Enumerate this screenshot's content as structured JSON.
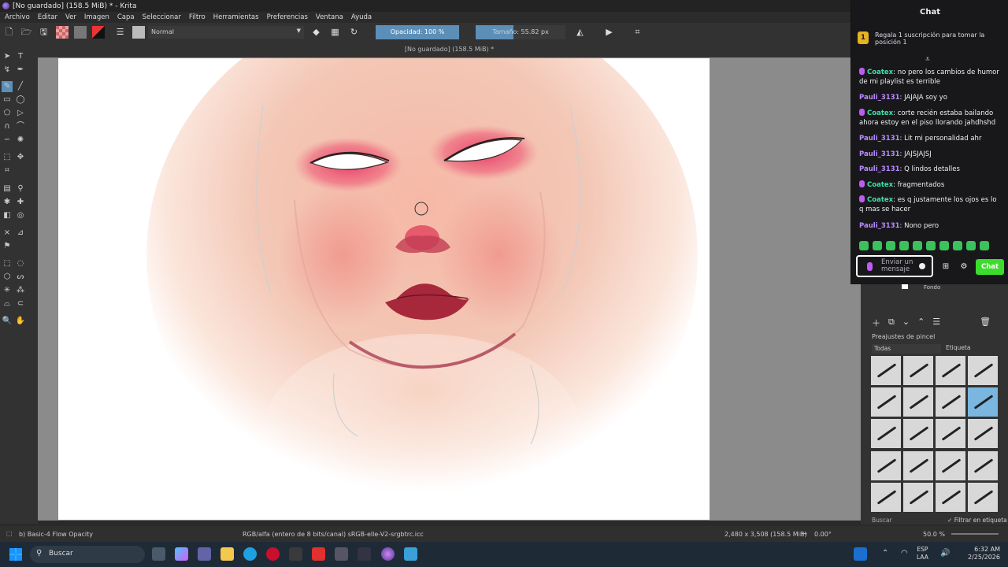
{
  "window": {
    "title": "[No guardado]  (158.5 MiB) * - Krita"
  },
  "menu": [
    "Archivo",
    "Editar",
    "Ver",
    "Imagen",
    "Capa",
    "Seleccionar",
    "Filtro",
    "Herramientas",
    "Preferencias",
    "Ventana",
    "Ayuda"
  ],
  "toolbar": {
    "blend_mode": "Normal",
    "opacity_label": "Opacidad: 100 %",
    "opacity_value": 100,
    "size_label": "Tamaño: 55.82 px",
    "size_fill_fraction": 0.42
  },
  "document": {
    "tab_title": "[No guardado]  (158.5 MiB) *"
  },
  "chat": {
    "title": "Chat",
    "promo": "Regala 1 suscripción para tomar la posición 1",
    "promo_rank": "1",
    "messages": [
      {
        "user": "Coatex",
        "text": ": no pero los cambios de humor de mi playlist es terrible",
        "role": "mod"
      },
      {
        "user": "Pauli_3131",
        "text": ": JAJAJA soy yo",
        "role": "viewer"
      },
      {
        "user": "Coatex",
        "text": ": corte recién estaba bailando ahora estoy en el piso llorando jahdhshd",
        "role": "mod"
      },
      {
        "user": "Pauli_3131",
        "text": ": Lit mi personalidad ahr",
        "role": "viewer"
      },
      {
        "user": "Pauli_3131",
        "text": ": JAJSJAJSJ",
        "role": "viewer"
      },
      {
        "user": "Pauli_3131",
        "text": ": Q lindos detalles",
        "role": "viewer"
      },
      {
        "user": "Coatex",
        "text": ": fragmentados",
        "role": "mod"
      },
      {
        "user": "Coatex",
        "text": ": es q justamente los ojos es lo q mas se hacer",
        "role": "mod"
      },
      {
        "user": "Pauli_3131",
        "text": ": Nono pero",
        "role": "viewer"
      }
    ],
    "input_placeholder": "Enviar un mensaje",
    "send_label": "Chat"
  },
  "layers": {
    "visible_layer": "Fondo"
  },
  "brush_presets": {
    "title": "Preajustes de pincel",
    "filter_value": "Todas",
    "tag_label": "Etiqueta",
    "search_placeholder": "Buscar",
    "filter_tag_label": "Filtrar en etiqueta",
    "selected_index": 7
  },
  "status": {
    "brush_name": "b) Basic-4 Flow Opacity",
    "color_space": "RGB/alfa (entero de 8 bits/canal)  sRGB-elle-V2-srgbtrc.icc",
    "image_size": "2,480 x 3,508 (158.5 MiB)",
    "rotation": "0.00°",
    "zoom": "50.0 %"
  },
  "taskbar": {
    "search_placeholder": "Buscar",
    "lang_primary": "ESP",
    "lang_secondary": "LAA",
    "time": "6:32 AM",
    "date": "2/25/2026"
  },
  "colors": {
    "accent": "#5c8fb8",
    "chat_send": "#3cdc2c",
    "mod_name": "#3ee0a6",
    "viewer_name": "#b98bff"
  }
}
